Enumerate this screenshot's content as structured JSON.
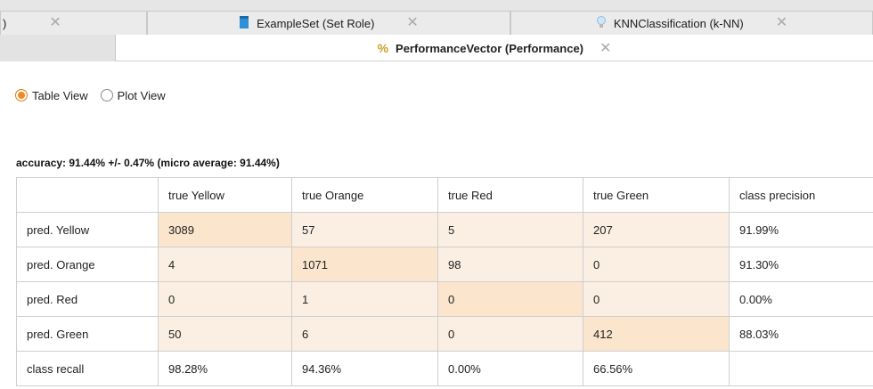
{
  "tabs_row1": [
    {
      "label": ")",
      "icon": ""
    },
    {
      "label": "ExampleSet (Set Role)",
      "icon": "table-icon"
    },
    {
      "label": "KNNClassification (k-NN)",
      "icon": "lightbulb-icon"
    }
  ],
  "tabs_row2": {
    "label": "PerformanceVector (Performance)",
    "icon": "percent-icon"
  },
  "view_options": [
    {
      "label": "Table View",
      "selected": true
    },
    {
      "label": "Plot View",
      "selected": false
    }
  ],
  "accuracy": "accuracy: 91.44% +/- 0.47% (micro average: 91.44%)",
  "matrix": {
    "headers": [
      "",
      "true Yellow",
      "true Orange",
      "true Red",
      "true Green",
      "class precision"
    ],
    "rows": [
      [
        "pred. Yellow",
        "3089",
        "57",
        "5",
        "207",
        "91.99%"
      ],
      [
        "pred. Orange",
        "4",
        "1071",
        "98",
        "0",
        "91.30%"
      ],
      [
        "pred. Red",
        "0",
        "1",
        "0",
        "0",
        "0.00%"
      ],
      [
        "pred. Green",
        "50",
        "6",
        "0",
        "412",
        "88.03%"
      ],
      [
        "class recall",
        "98.28%",
        "94.36%",
        "0.00%",
        "66.56%",
        ""
      ]
    ]
  },
  "colors": {
    "diagonal": "#fbe5cd",
    "off_diagonal": "#faefe2",
    "radio_selected": "#f28a1e"
  }
}
